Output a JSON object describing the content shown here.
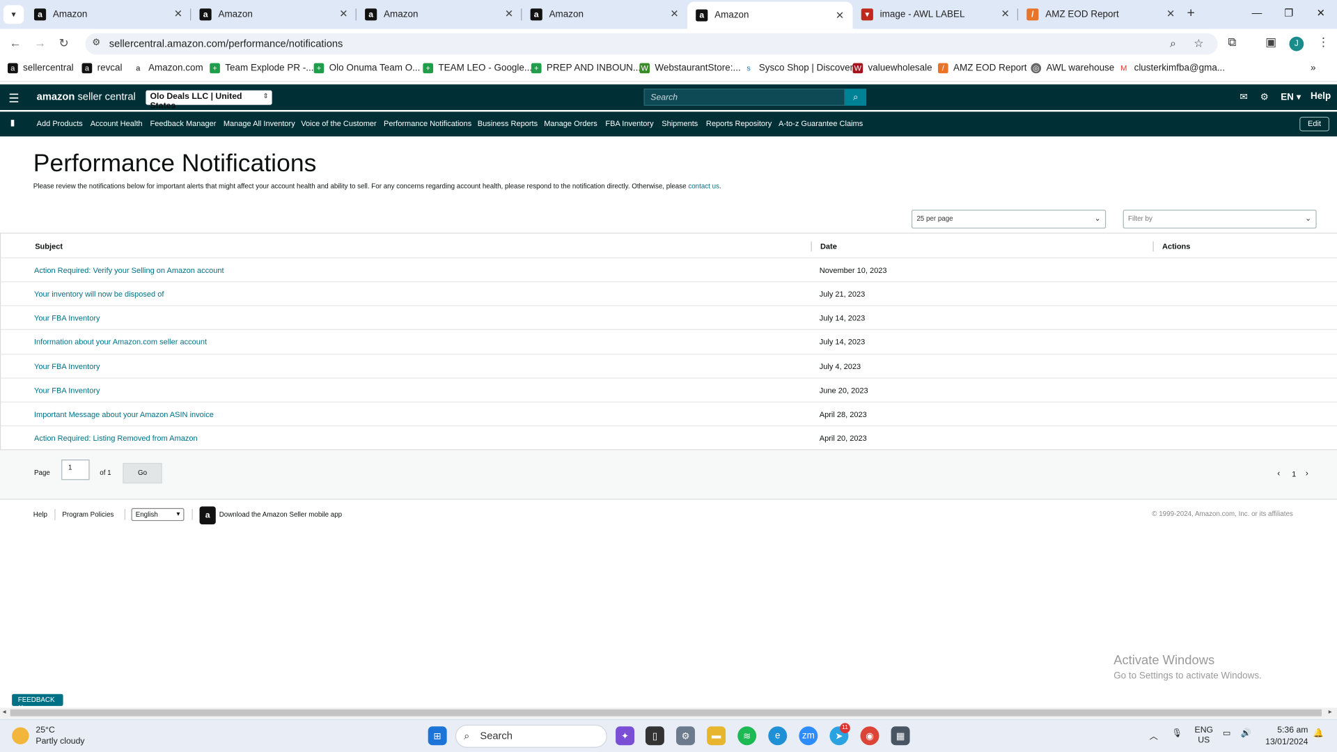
{
  "browser": {
    "tabs": [
      {
        "title": "Amazon"
      },
      {
        "title": "Amazon"
      },
      {
        "title": "Amazon"
      },
      {
        "title": "Amazon"
      },
      {
        "title": "Amazon"
      },
      {
        "title": "image - AWL LABEL"
      },
      {
        "title": "AMZ EOD Report"
      }
    ],
    "url": "sellercentral.amazon.com/performance/notifications",
    "avatar_letter": "J",
    "bookmarks": [
      {
        "label": "sellercentral"
      },
      {
        "label": "revcal"
      },
      {
        "label": "Amazon.com"
      },
      {
        "label": "Team Explode PR -..."
      },
      {
        "label": "Olo Onuma Team O..."
      },
      {
        "label": "TEAM LEO - Google..."
      },
      {
        "label": "PREP AND INBOUN..."
      },
      {
        "label": "WebstaurantStore:..."
      },
      {
        "label": "Sysco Shop | Discover"
      },
      {
        "label": "valuewholesale"
      },
      {
        "label": "AMZ EOD Report"
      },
      {
        "label": "AWL warehouse"
      },
      {
        "label": "clusterkimfba@gma..."
      }
    ]
  },
  "header": {
    "logo_bold": "amazon",
    "logo_rest": " seller central",
    "account": "Olo Deals LLC | United States",
    "search_placeholder": "Search",
    "lang": "EN",
    "help": "Help"
  },
  "nav": {
    "items": [
      "Add Products",
      "Account Health",
      "Feedback Manager",
      "Manage All Inventory",
      "Voice of the Customer",
      "Performance Notifications",
      "Business Reports",
      "Manage Orders",
      "FBA Inventory",
      "Shipments",
      "Reports Repository",
      "A-to-z Guarantee Claims"
    ],
    "edit": "Edit"
  },
  "page": {
    "title": "Performance Notifications",
    "intro": "Please review the notifications below for important alerts that might affect your account health and ability to sell. For any concerns regarding account health, please respond to the notification directly. Otherwise, please ",
    "intro_link": "contact us",
    "intro_end": ".",
    "per_page": "25 per page",
    "filter": "Filter by"
  },
  "table": {
    "headers": {
      "subject": "Subject",
      "date": "Date",
      "actions": "Actions"
    },
    "rows": [
      {
        "subject": "Action Required: Verify your Selling on Amazon account",
        "date": "November 10, 2023"
      },
      {
        "subject": "Your inventory will now be disposed of",
        "date": "July 21, 2023"
      },
      {
        "subject": "Your FBA Inventory",
        "date": "July 14, 2023"
      },
      {
        "subject": "Information about your Amazon.com seller account",
        "date": "July 14, 2023"
      },
      {
        "subject": "Your FBA Inventory",
        "date": "July 4, 2023"
      },
      {
        "subject": "Your FBA Inventory",
        "date": "June 20, 2023"
      },
      {
        "subject": "Important Message about your Amazon ASIN invoice",
        "date": "April 28, 2023"
      },
      {
        "subject": "Action Required: Listing Removed from Amazon",
        "date": "April 20, 2023"
      }
    ]
  },
  "pager": {
    "page_label": "Page",
    "page_value": "1",
    "of": "of 1",
    "go": "Go",
    "current": "1"
  },
  "footer": {
    "help": "Help",
    "policies": "Program Policies",
    "language": "English",
    "app": "Download the Amazon Seller mobile app",
    "copyright": "© 1999-2024, Amazon.com, Inc. or its affiliates"
  },
  "overlay": {
    "activate_title": "Activate Windows",
    "activate_sub": "Go to Settings to activate Windows.",
    "feedback": "FEEDBACK ✕"
  },
  "taskbar": {
    "temp": "25°C",
    "weather": "Partly cloudy",
    "search": "Search",
    "lang1": "ENG",
    "lang2": "US",
    "time": "5:36 am",
    "date": "13/01/2024",
    "telegram_badge": "11"
  }
}
